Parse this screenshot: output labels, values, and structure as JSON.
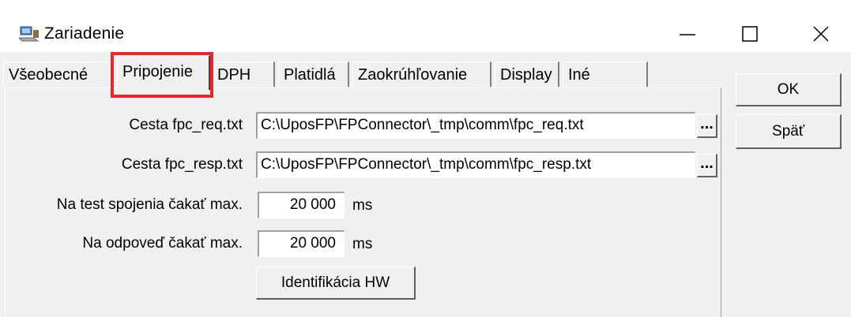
{
  "window": {
    "title": "Zariadenie",
    "icon": "computer-icon"
  },
  "tabs": [
    {
      "label": "Všeobecné",
      "active": false
    },
    {
      "label": "Pripojenie",
      "active": true
    },
    {
      "label": "DPH",
      "active": false
    },
    {
      "label": "Platidlá",
      "active": false
    },
    {
      "label": "Zaokrúhľovanie",
      "active": false
    },
    {
      "label": "Display",
      "active": false
    },
    {
      "label": "Iné",
      "active": false
    }
  ],
  "form": {
    "req_label": "Cesta fpc_req.txt",
    "req_value": "C:\\UposFP\\FPConnector\\_tmp\\comm\\fpc_req.txt",
    "resp_label": "Cesta fpc_resp.txt",
    "resp_value": "C:\\UposFP\\FPConnector\\_tmp\\comm\\fpc_resp.txt",
    "browse_label": "...",
    "test_wait_label": "Na test spojenia čakať max.",
    "test_wait_value": "20 000",
    "test_wait_unit": "ms",
    "reply_wait_label": "Na odpoveď čakať max.",
    "reply_wait_value": "20 000",
    "reply_wait_unit": "ms",
    "identify_button": "Identifikácia HW"
  },
  "buttons": {
    "ok": "OK",
    "back": "Späť"
  },
  "colors": {
    "highlight": "#e8262d",
    "dialog_bg": "#f0f0f0",
    "titlebar_bg": "#ffffff"
  }
}
